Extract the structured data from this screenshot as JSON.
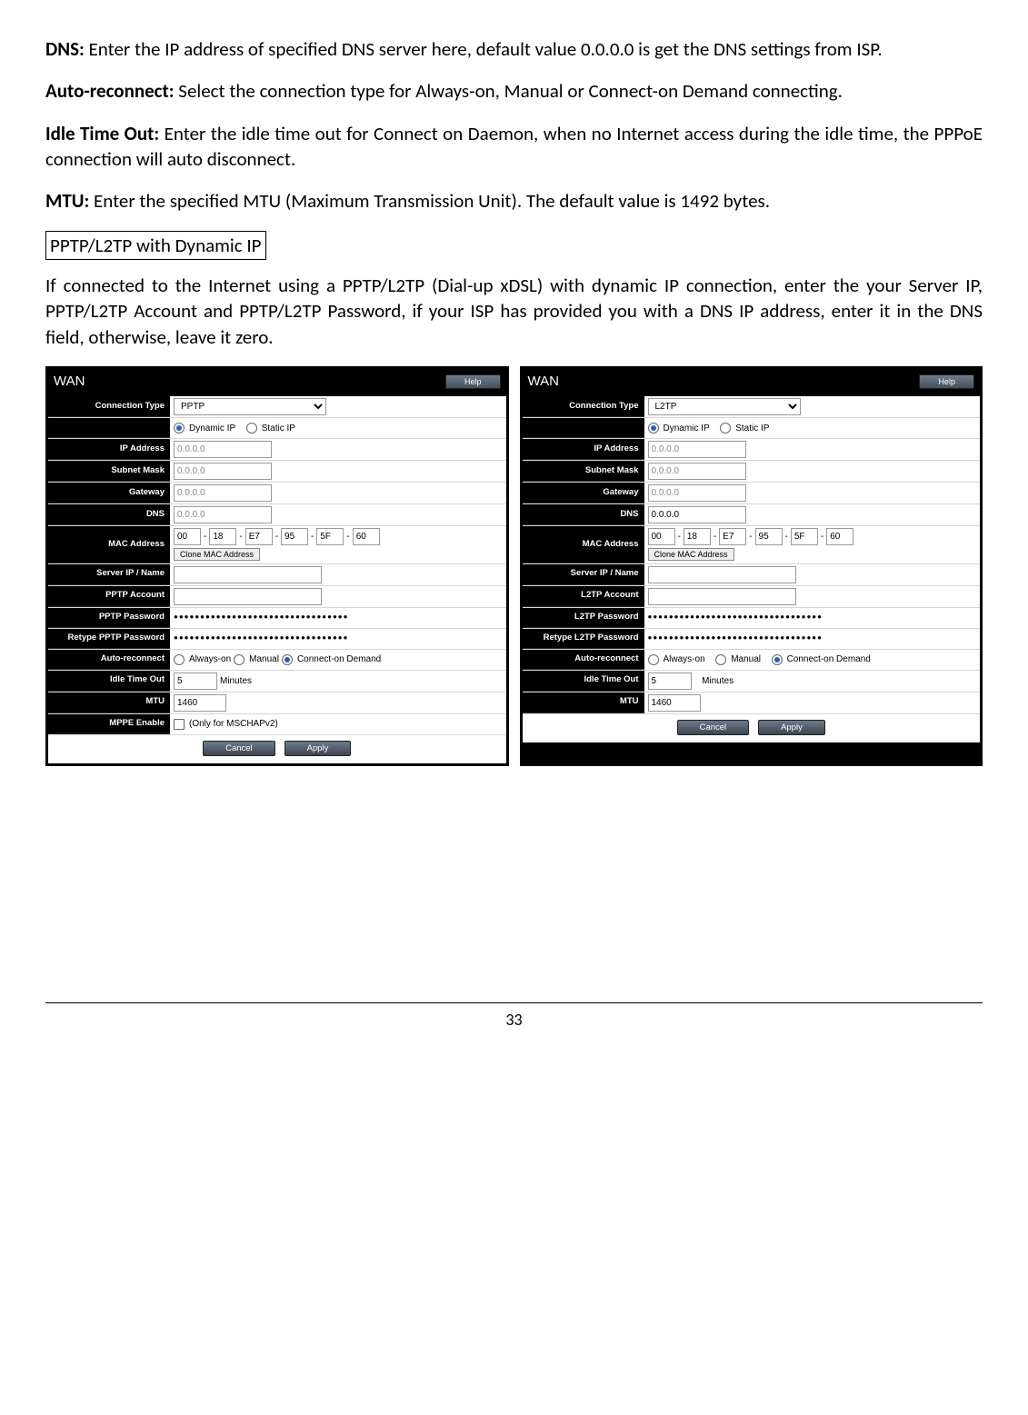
{
  "paragraphs": {
    "dns_label": "DNS:",
    "dns_text": " Enter the IP address of specified DNS server here, default value 0.0.0.0 is get the DNS settings from ISP.",
    "auto_label": "Auto-reconnect:",
    "auto_text": " Select the connection type for Always-on, Manual or Connect-on Demand connecting.",
    "idle_label": "Idle Time Out:",
    "idle_text": " Enter the idle time out for Connect on Daemon, when no Internet access during the idle time, the PPPoE connection will auto disconnect.",
    "mtu_label": "MTU:",
    "mtu_text": " Enter the specified MTU (Maximum Transmission Unit). The default value is 1492 bytes.",
    "section_box": "PPTP/L2TP with Dynamic IP",
    "intro": "If connected to the Internet using a PPTP/L2TP (Dial-up xDSL) with dynamic IP connection, enter the your Server IP, PPTP/L2TP Account and PPTP/L2TP Password, if your ISP has provided you with a DNS IP address, enter it in the DNS field, otherwise, leave it zero."
  },
  "common": {
    "wan_title": "WAN",
    "help_label": "Help",
    "dynamic_ip": "Dynamic IP",
    "static_ip": "Static IP",
    "always_on": "Always-on",
    "manual": "Manual",
    "connect_on_demand": "Connect-on Demand",
    "minutes": "Minutes",
    "clone_mac": "Clone MAC Address",
    "cancel": "Cancel",
    "apply": "Apply",
    "ip_zero": "0.0.0.0",
    "mac": [
      "00",
      "18",
      "E7",
      "95",
      "5F",
      "60"
    ],
    "mppe_note": "(Only for MSCHAPv2)",
    "idle_val": "5",
    "mtu_val": "1460",
    "pw_dots": "●●●●●●●●●●●●●●●●●●●●●●●●●●●●●●●●●"
  },
  "labels": {
    "connection_type": "Connection Type",
    "ip_address": "IP Address",
    "subnet_mask": "Subnet Mask",
    "gateway": "Gateway",
    "dns": "DNS",
    "mac_address": "MAC Address",
    "server_ip": "Server IP / Name",
    "auto_reconnect": "Auto-reconnect",
    "idle_time_out": "Idle Time Out",
    "mtu": "MTU",
    "mppe_enable": "MPPE Enable"
  },
  "pptp": {
    "conn_type_val": "PPTP",
    "account_label": "PPTP Account",
    "password_label": "PPTP Password",
    "retype_label": "Retype PPTP Password"
  },
  "l2tp": {
    "conn_type_val": "L2TP",
    "account_label": "L2TP Account",
    "password_label": "L2TP Password",
    "retype_label": "Retype L2TP Password"
  },
  "page_number": "33"
}
